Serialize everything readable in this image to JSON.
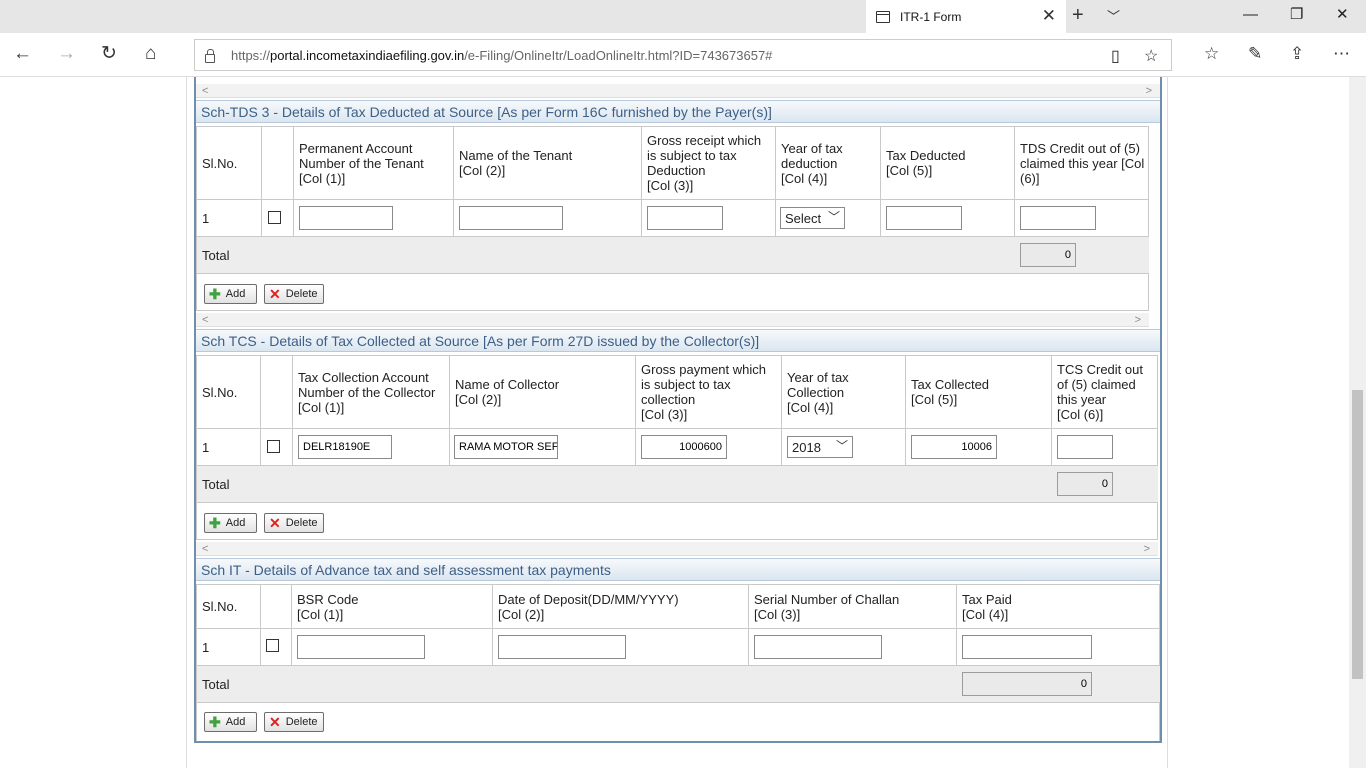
{
  "browser": {
    "tab_title": "ITR-1 Form",
    "url_protocol": "https://",
    "url_host": "portal.incometaxindiaefiling.gov.in",
    "url_path": "/e-Filing/OnlineItr/LoadOnlineItr.html?ID=743673657#"
  },
  "tds3": {
    "heading": "Sch-TDS 3 - Details of Tax Deducted at Source [As per Form 16C furnished by the Payer(s)]",
    "col_slno": "Sl.No.",
    "col1": [
      "Permanent Account",
      "Number of the Tenant",
      "[Col (1)]"
    ],
    "col2": [
      "Name of the Tenant",
      "[Col (2)]"
    ],
    "col3": [
      "Gross receipt which",
      "is subject to tax",
      "Deduction",
      "[Col (3)]"
    ],
    "col4": [
      "Year of tax",
      "deduction",
      "[Col (4)]"
    ],
    "col5": [
      "Tax Deducted",
      "[Col (5)]"
    ],
    "col6": [
      "TDS Credit out of (5)",
      "claimed this year [Col",
      "(6)]"
    ],
    "row_no": "1",
    "year_select": "Select",
    "total_label": "Total",
    "total_value": "0",
    "add": "Add",
    "delete": "Delete"
  },
  "tcs": {
    "heading": "Sch TCS - Details of Tax Collected at Source [As per Form 27D issued by the Collector(s)]",
    "col_slno": "Sl.No.",
    "col1": [
      "Tax Collection Account",
      "Number of the Collector",
      "[Col (1)]"
    ],
    "col2": [
      "Name of Collector",
      "[Col (2)]"
    ],
    "col3": [
      "Gross payment which",
      "is subject to tax",
      "collection",
      "[Col (3)]"
    ],
    "col4": [
      "Year of tax",
      "Collection",
      "[Col (4)]"
    ],
    "col5": [
      "Tax Collected",
      "[Col (5)]"
    ],
    "col6": [
      "TCS Credit out",
      "of (5) claimed",
      "this year",
      "[Col (6)]"
    ],
    "row_no": "1",
    "tan": "DELR18190E",
    "collector": "RAMA MOTOR SEF",
    "gross": "1000600",
    "year": "2018",
    "tax_collected": "10006",
    "total_label": "Total",
    "total_value": "0",
    "add": "Add",
    "delete": "Delete"
  },
  "it": {
    "heading": "Sch IT - Details of Advance tax and self assessment tax payments",
    "col_slno": "Sl.No.",
    "col1": [
      "BSR Code",
      "[Col (1)]"
    ],
    "col2": [
      "Date of Deposit(DD/MM/YYYY)",
      "[Col (2)]"
    ],
    "col3": [
      "Serial Number of Challan",
      "[Col (3)]"
    ],
    "col4": [
      "Tax Paid",
      "[Col (4)]"
    ],
    "row_no": "1",
    "total_label": "Total",
    "total_value": "0",
    "add": "Add",
    "delete": "Delete"
  }
}
